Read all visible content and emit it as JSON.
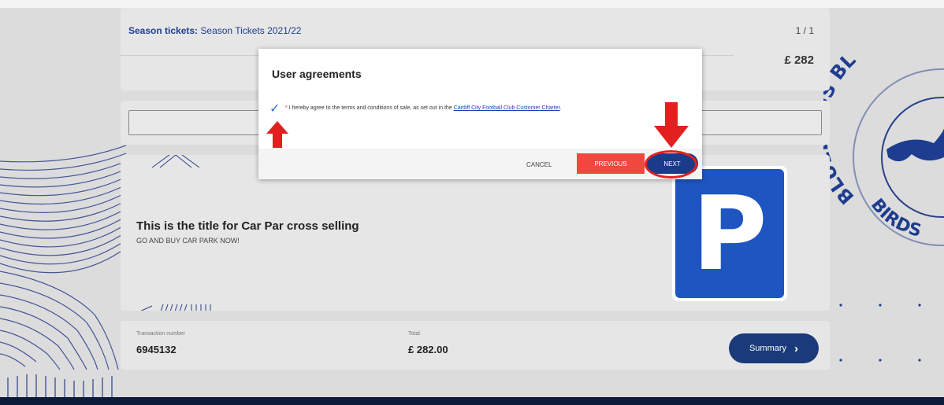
{
  "season": {
    "label": "Season tickets:",
    "name": "Season Tickets 2021/22",
    "count": "1 / 1",
    "price": "£ 282"
  },
  "promo": {
    "title": "This is the title for Car Par cross selling",
    "subtitle": "GO AND BUY CAR PARK NOW!",
    "sign_letter": "P"
  },
  "footer": {
    "transaction_label": "Transaction number",
    "transaction_value": "6945132",
    "total_label": "Total",
    "total_value": "£ 282.00",
    "summary_label": "Summary"
  },
  "modal": {
    "title": "User agreements",
    "agreement_prefix": "I hereby agree to the terms and conditions of sale, as set out in the",
    "agreement_link": "Cardiff City Football Club Customer Charter",
    "cancel_label": "CANCEL",
    "previous_label": "PREVIOUS",
    "next_label": "NEXT"
  },
  "crest": {
    "top_text": "BLUEBIRDS BL",
    "bottom_text": "BIRDS"
  },
  "colors": {
    "navy": "#1a3a7a",
    "red": "#f0483e",
    "annotation_red": "#e32020",
    "brand_blue": "#1f55c1"
  }
}
